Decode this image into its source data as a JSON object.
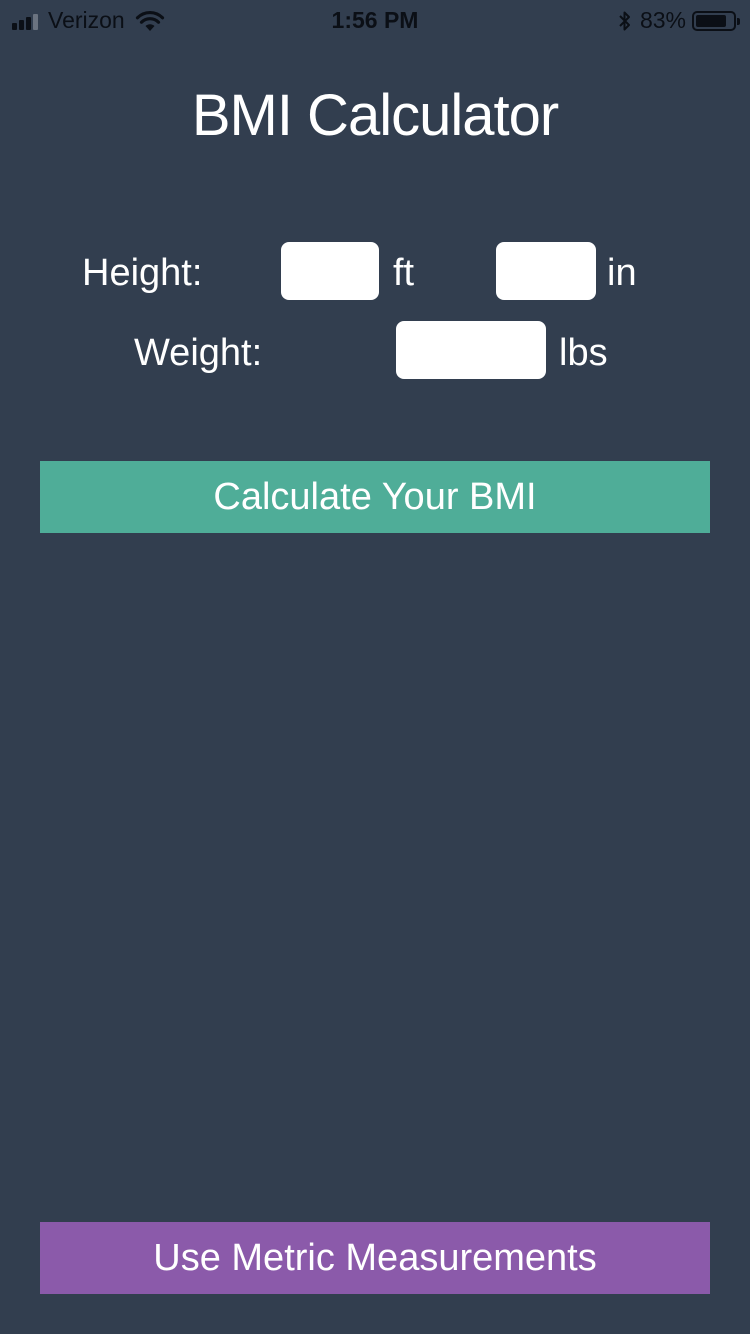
{
  "status_bar": {
    "carrier": "Verizon",
    "time": "1:56 PM",
    "battery_percent": "83%",
    "battery_level": 0.83,
    "signal_bars": 3,
    "signal_bars_total": 4,
    "icons": [
      "signal-icon",
      "wifi-icon",
      "bluetooth-icon",
      "battery-icon"
    ]
  },
  "app": {
    "title": "BMI Calculator"
  },
  "form": {
    "height_label": "Height:",
    "feet_value": "",
    "feet_unit": "ft",
    "inches_value": "",
    "inches_unit": "in",
    "weight_label": "Weight:",
    "weight_value": "",
    "weight_unit": "lbs"
  },
  "actions": {
    "calculate_label": "Calculate Your BMI",
    "metric_label": "Use Metric Measurements"
  },
  "colors": {
    "background": "#323e4f",
    "calculate_button": "#4fad98",
    "metric_button": "#8b5aaa"
  }
}
